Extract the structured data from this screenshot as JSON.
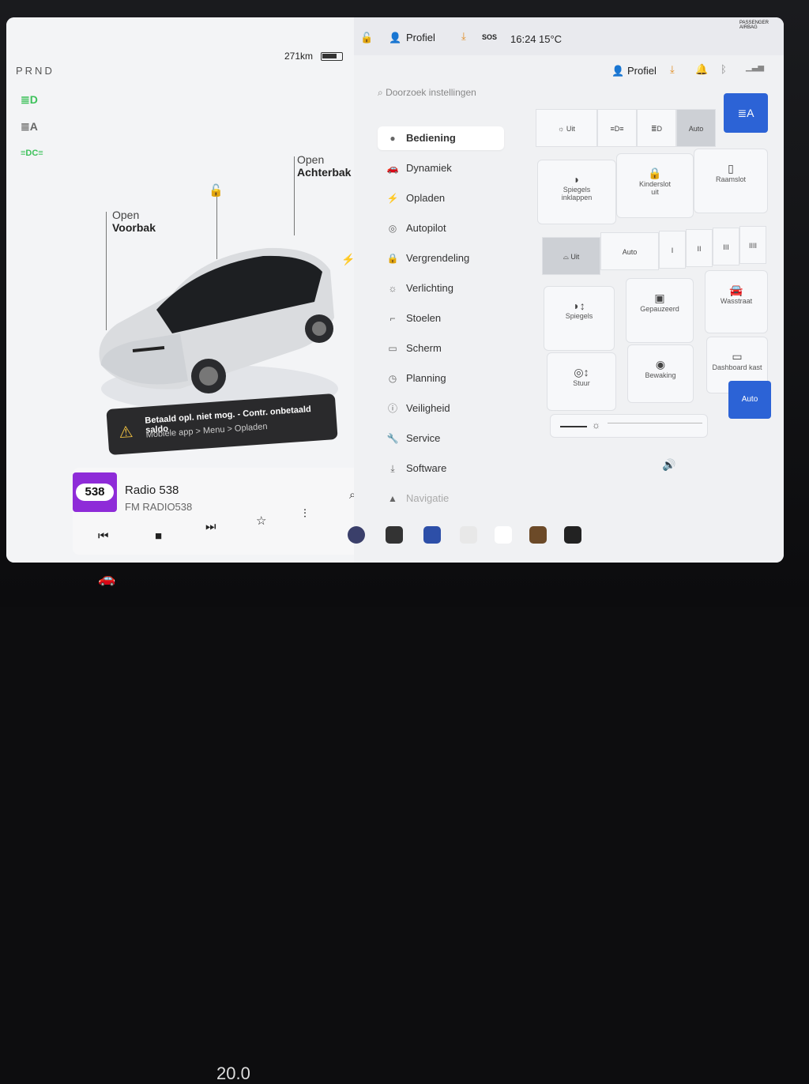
{
  "gear": "PRND",
  "battery": {
    "range": "271km"
  },
  "lights": [
    {
      "name": "low-beam-icon",
      "glyph": "≣D"
    },
    {
      "name": "auto-headlight-icon",
      "glyph": "≣A"
    },
    {
      "name": "parking-light-icon",
      "glyph": "≡DC≡"
    }
  ],
  "callouts": {
    "frunk": {
      "label1": "Open",
      "label2": "Voorbak"
    },
    "trunk": {
      "label1": "Open",
      "label2": "Achterbak"
    }
  },
  "alert": {
    "line1": "Betaald opl. niet mog. - Contr. onbetaald saldo",
    "line2": "Mobiele app > Menu > Opladen"
  },
  "media": {
    "logo": "538",
    "station": "Radio 538",
    "source": "FM RADIO538"
  },
  "status": {
    "profile": "Profiel",
    "sos": "SOS",
    "time": "16:24",
    "temp": "15°C",
    "airbag": "PASSENGER AIRBAG"
  },
  "settings": {
    "profile": "Profiel",
    "search_placeholder": "Doorzoek instellingen",
    "menu": [
      {
        "label": "Bediening",
        "icon": "toggle-icon",
        "active": true
      },
      {
        "label": "Dynamiek",
        "icon": "car-icon",
        "active": false
      },
      {
        "label": "Opladen",
        "icon": "bolt-icon",
        "active": false
      },
      {
        "label": "Autopilot",
        "icon": "steering-icon",
        "active": false
      },
      {
        "label": "Vergrendeling",
        "icon": "lock-icon",
        "active": false
      },
      {
        "label": "Verlichting",
        "icon": "sun-icon",
        "active": false
      },
      {
        "label": "Stoelen",
        "icon": "seat-icon",
        "active": false
      },
      {
        "label": "Scherm",
        "icon": "screen-icon",
        "active": false
      },
      {
        "label": "Planning",
        "icon": "clock-icon",
        "active": false
      },
      {
        "label": "Veiligheid",
        "icon": "info-icon",
        "active": false
      },
      {
        "label": "Service",
        "icon": "wrench-icon",
        "active": false
      },
      {
        "label": "Software",
        "icon": "download-icon",
        "active": false
      },
      {
        "label": "Navigatie",
        "icon": "nav-icon",
        "active": false
      }
    ],
    "lights_row": {
      "off": "Uit",
      "auto": "Auto"
    },
    "tiles1": [
      {
        "label1": "Spiegels",
        "label2": "inklappen"
      },
      {
        "label1": "Kinderslot",
        "label2": "uit"
      },
      {
        "label1": "Raamslot",
        "label2": ""
      }
    ],
    "wiper_row": {
      "off": "Uit",
      "auto": "Auto",
      "i": "I",
      "ii": "II",
      "iii": "III",
      "iiii": "IIII"
    },
    "tiles2": [
      {
        "label": "Spiegels"
      },
      {
        "label": "Gepauzeerd"
      },
      {
        "label": "Wasstraat"
      },
      {
        "label": "Stuur"
      },
      {
        "label": "Bewaking"
      },
      {
        "label": "Dashboard kast"
      }
    ],
    "auto_button": "Auto"
  },
  "climate": {
    "temp": "20.0"
  }
}
